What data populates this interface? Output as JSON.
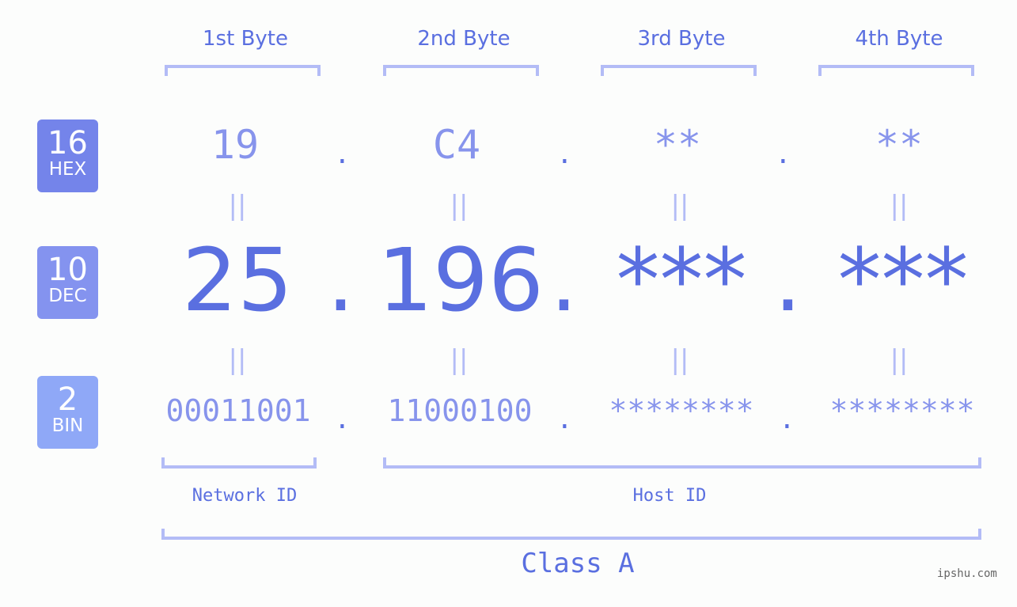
{
  "headers": [
    "1st Byte",
    "2nd Byte",
    "3rd Byte",
    "4th Byte"
  ],
  "badges": [
    {
      "number": "16",
      "label": "HEX",
      "color": "#7484ea"
    },
    {
      "number": "10",
      "label": "DEC",
      "color": "#8493ef"
    },
    {
      "number": "2",
      "label": "BIN",
      "color": "#8fa8f7"
    }
  ],
  "hex": [
    "19",
    "C4",
    "**",
    "**"
  ],
  "dec": [
    "25",
    "196",
    "***",
    "***"
  ],
  "bin": [
    "00011001",
    "11000100",
    "********",
    "********"
  ],
  "separator": ".",
  "equals": "||",
  "labels": {
    "network": "Network ID",
    "host": "Host ID",
    "class": "Class A"
  },
  "watermark": "ipshu.com"
}
